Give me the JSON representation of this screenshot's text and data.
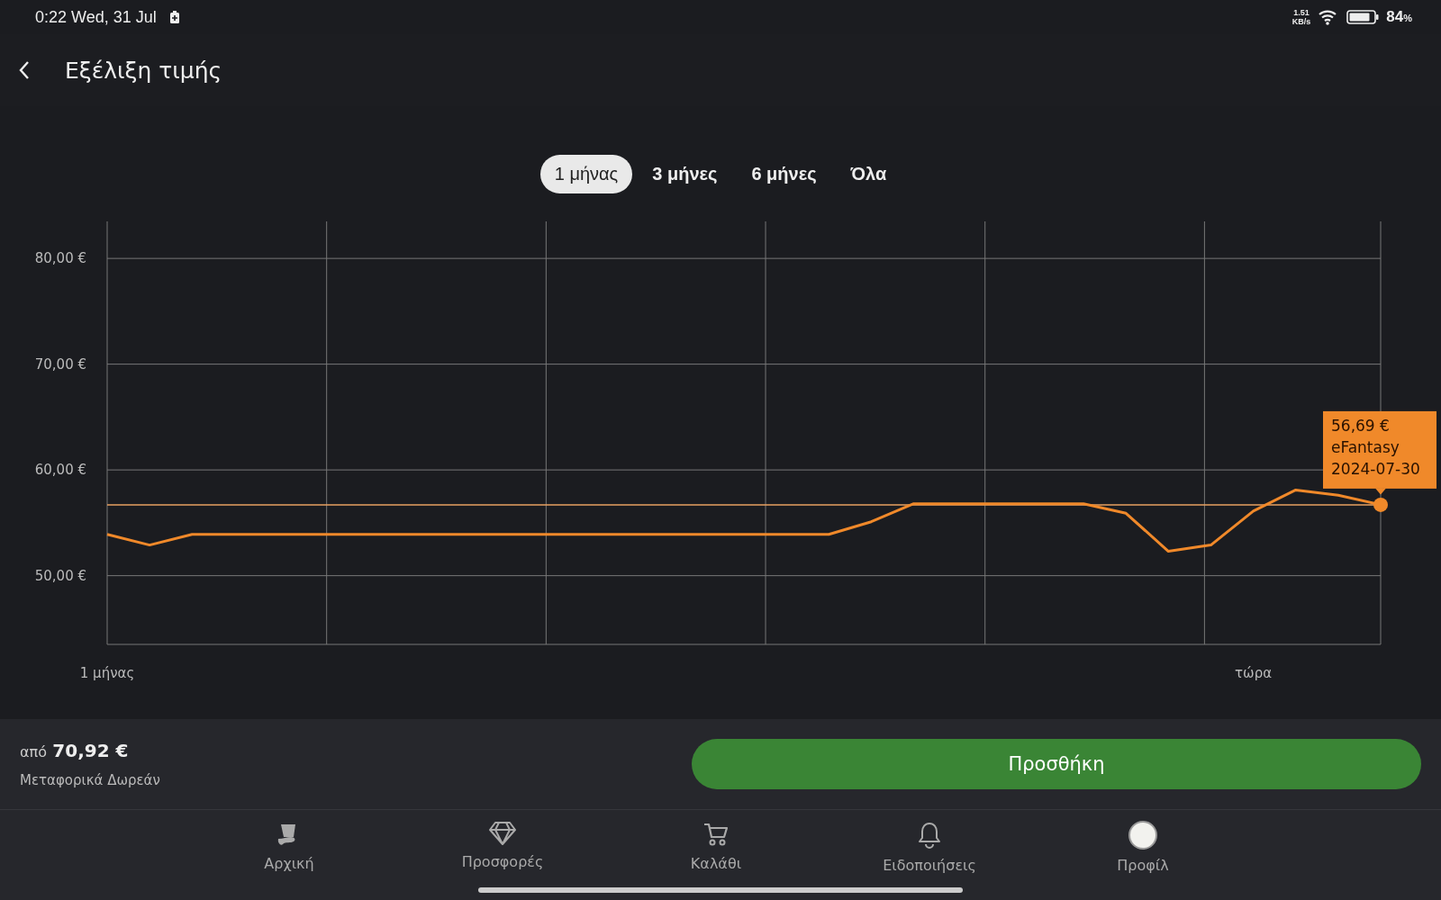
{
  "status_bar": {
    "time": "0:22 Wed, 31 Jul",
    "speed_value": "1.51",
    "speed_unit": "KB/s",
    "battery": "84",
    "battery_unit": "%"
  },
  "header": {
    "title": "Εξέλιξη τιμής"
  },
  "tabs": [
    {
      "label": "1 μήνας",
      "selected": true
    },
    {
      "label": "3 μήνες",
      "selected": false
    },
    {
      "label": "6 μήνες",
      "selected": false
    },
    {
      "label": "Όλα",
      "selected": false
    }
  ],
  "chart": {
    "chart_data": {
      "type": "line",
      "categories": [
        "1 μήνας",
        null,
        null,
        null,
        null,
        null,
        null,
        null,
        null,
        null,
        null,
        null,
        null,
        null,
        null,
        null,
        null,
        null,
        null,
        null,
        null,
        null,
        null,
        null,
        null,
        null,
        null,
        "τώρα",
        null,
        null,
        null
      ],
      "series": [
        {
          "color": "#f0892a",
          "values": [
            53.9,
            52.9,
            53.9,
            53.9,
            53.9,
            53.9,
            53.9,
            53.9,
            53.9,
            53.9,
            53.9,
            53.9,
            53.9,
            53.9,
            53.9,
            53.9,
            53.9,
            53.9,
            55.1,
            56.8,
            56.8,
            56.8,
            56.8,
            56.8,
            55.9,
            52.3,
            52.9,
            56.1,
            58.1,
            57.6,
            56.7
          ]
        },
        {
          "color": "#e8a060",
          "values": [
            56.7,
            56.7,
            56.7,
            56.7,
            56.7,
            56.7,
            56.7,
            56.7,
            56.7,
            56.7,
            56.7,
            56.7,
            56.7,
            56.7,
            56.7,
            56.7,
            56.7,
            56.7,
            56.7,
            56.7,
            56.7,
            56.7,
            56.7,
            56.7,
            56.7,
            56.7,
            56.7,
            56.7,
            56.7,
            56.7,
            56.7
          ]
        }
      ],
      "ylim": [
        43.5,
        83.5
      ],
      "grid": true,
      "yticks": [
        {
          "value": 50,
          "label": "50,00 €"
        },
        {
          "value": 60,
          "label": "60,00 €"
        },
        {
          "value": 70,
          "label": "70,00 €"
        },
        {
          "value": 80,
          "label": "80,00 €"
        }
      ]
    },
    "tooltip": {
      "price": "56,69 €",
      "seller": "eFantasy",
      "date": "2024-07-30"
    }
  },
  "buy_bar": {
    "prefix": "από",
    "price": "70,92 €",
    "shipping": "Μεταφορικά Δωρεάν",
    "button": "Προσθήκη"
  },
  "nav": [
    {
      "kind": "hat",
      "label": "Αρχική"
    },
    {
      "kind": "diamond",
      "label": "Προσφορές"
    },
    {
      "kind": "cart",
      "label": "Καλάθι"
    },
    {
      "kind": "bell",
      "label": "Ειδοποιήσεις"
    },
    {
      "kind": "avatar",
      "label": "Προφίλ"
    }
  ]
}
